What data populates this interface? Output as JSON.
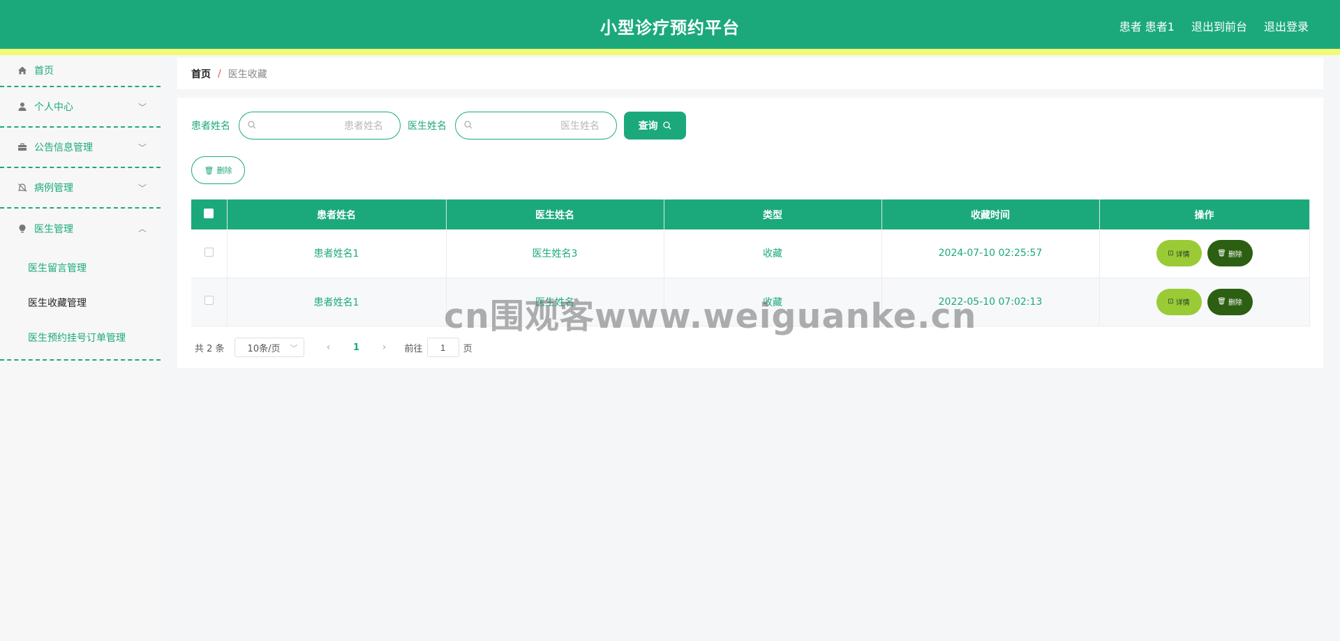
{
  "header": {
    "title": "小型诊疗预约平台",
    "user_label": "患者 患者1",
    "to_front": "退出到前台",
    "logout": "退出登录",
    "colors": {
      "primary": "#1ba97c",
      "stripe": "#f3fb75"
    }
  },
  "sidebar": {
    "items": [
      {
        "label": "首页",
        "icon": "home-icon"
      },
      {
        "label": "个人中心",
        "icon": "user-icon"
      },
      {
        "label": "公告信息管理",
        "icon": "briefcase-icon"
      },
      {
        "label": "病例管理",
        "icon": "bell-off-icon"
      },
      {
        "label": "医生管理",
        "icon": "bulb-icon"
      }
    ],
    "sub_items": [
      {
        "label": "医生留言管理"
      },
      {
        "label": "医生收藏管理"
      },
      {
        "label": "医生预约挂号订单管理"
      }
    ]
  },
  "breadcrumb": {
    "home": "首页",
    "separator": "/",
    "current": "医生收藏"
  },
  "search": {
    "patient_label": "患者姓名",
    "patient_placeholder": "患者姓名",
    "doctor_label": "医生姓名",
    "doctor_placeholder": "医生姓名",
    "button": "查询"
  },
  "toolbar": {
    "delete_label": "删除"
  },
  "table": {
    "columns": [
      "患者姓名",
      "医生姓名",
      "类型",
      "收藏时间",
      "操作"
    ],
    "rows": [
      {
        "patient": "患者姓名1",
        "doctor": "医生姓名3",
        "type": "收藏",
        "time": "2024-07-10 02:25:57",
        "detail": "详情",
        "delete": "删除"
      },
      {
        "patient": "患者姓名1",
        "doctor": "医生姓名",
        "type": "收藏",
        "time": "2022-05-10 07:02:13",
        "detail": "详情",
        "delete": "删除"
      }
    ]
  },
  "pagination": {
    "total": "共 2 条",
    "page_size": "10条/页",
    "current_page": "1",
    "goto_label": "前往",
    "goto_value": "1",
    "page_suffix": "页"
  },
  "watermark": "cn围观客www.weiguanke.cn"
}
